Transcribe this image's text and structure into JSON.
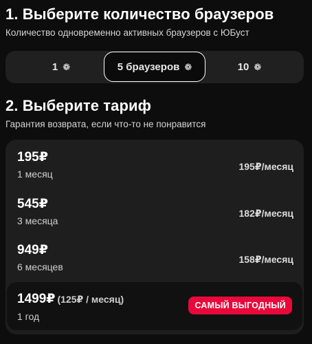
{
  "browsers": {
    "title": "1. Выберите количество браузеров",
    "subtitle": "Количество одновременно активных браузеров с ЮБуст",
    "options": [
      {
        "label": "1",
        "icon": "browser-icon",
        "selected": false
      },
      {
        "label": "5 браузеров",
        "icon": "browser-icon",
        "selected": true
      },
      {
        "label": "10",
        "icon": "browser-icon",
        "selected": false
      }
    ]
  },
  "tariff": {
    "title": "2. Выберите тариф",
    "subtitle": "Гарантия возврата, если что-то не понравится",
    "plans": [
      {
        "price": "195₽",
        "period": "1 месяц",
        "monthly": "195₽/месяц"
      },
      {
        "price": "545₽",
        "period": "3 месяца",
        "monthly": "182₽/месяц"
      },
      {
        "price": "949₽",
        "period": "6 месяцев",
        "monthly": "158₽/месяц"
      },
      {
        "price": "1499₽",
        "per_month": "(125₽ / месяц)",
        "period": "1 год",
        "badge": "САМЫЙ ВЫГОДНЫЙ"
      }
    ]
  },
  "colors": {
    "background": "#0d0d0d",
    "panel": "#1e1e1e",
    "badge": "#e8093a"
  }
}
